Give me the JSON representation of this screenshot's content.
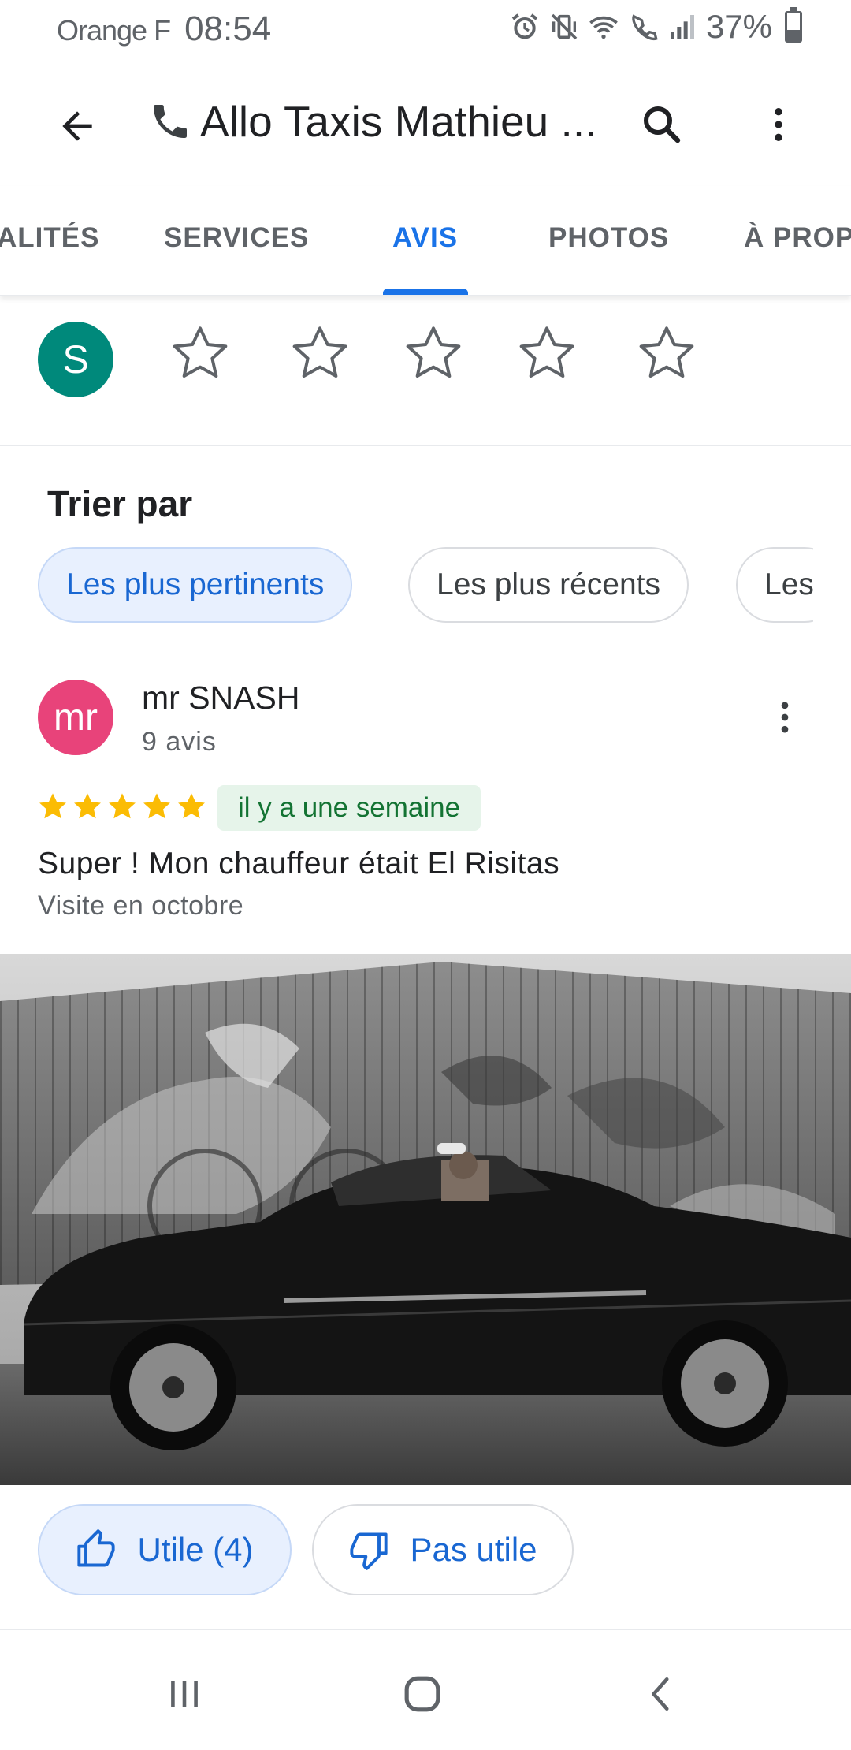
{
  "status_bar": {
    "carrier": "Orange F",
    "time": "08:54",
    "battery": "37%",
    "battery_level": 0.37,
    "icons": [
      "alarm-icon",
      "vibrate-mute-icon",
      "wifi-icon",
      "wifi-calling-icon",
      "signal-icon"
    ]
  },
  "app_bar": {
    "title_icon": "phone-icon",
    "title": "Allo Taxis Mathieu ...",
    "back_icon": "arrow-back-icon",
    "search_icon": "search-icon",
    "more_icon": "more-vert-icon"
  },
  "tabs": [
    {
      "label": "ALITÉS",
      "active": false
    },
    {
      "label": "SERVICES",
      "active": false
    },
    {
      "label": "AVIS",
      "active": true
    },
    {
      "label": "PHOTOS",
      "active": false
    },
    {
      "label": "À PROPOS",
      "active": false
    }
  ],
  "rate": {
    "user_initial": "S",
    "star_count": 5,
    "colors": {
      "avatar": "#00897b",
      "star_outline": "#5f6368"
    }
  },
  "sort": {
    "title": "Trier par",
    "chips": [
      "Les plus pertinents",
      "Les plus récents",
      "Les"
    ],
    "selected": "Les plus pertinents"
  },
  "review": {
    "avatar_initials": "mr",
    "avatar_color": "#e8437a",
    "author": "mr SNASH",
    "review_count": "9 avis",
    "rating": 5,
    "date_badge": "il y a une semaine",
    "text": "Super ! Mon chauffeur était El Risitas",
    "visit": "Visite en octobre",
    "star_color": "#fbbc04"
  },
  "actions": {
    "helpful_label": "Utile (4)",
    "not_helpful_label": "Pas utile",
    "helpful_icon": "thumb-up-icon",
    "not_helpful_icon": "thumb-down-icon"
  },
  "nav": {
    "recents_icon": "recents-icon",
    "home_icon": "home-icon",
    "back_icon": "nav-back-icon"
  },
  "colors": {
    "accent": "#1a73e8",
    "chip_selected_bg": "#e8f0fe",
    "date_badge_bg": "#e6f4ea",
    "date_badge_text": "#137333"
  }
}
